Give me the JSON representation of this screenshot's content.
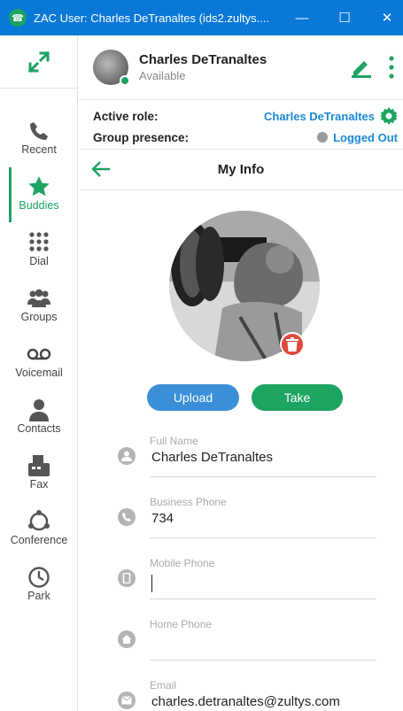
{
  "window": {
    "title": "ZAC User: Charles DeTranaltes (ids2.zultys....",
    "minimize": "—",
    "maximize": "☐",
    "close": "✕"
  },
  "sidebar": {
    "items": [
      {
        "label": "Recent",
        "icon": "phone-icon"
      },
      {
        "label": "Buddies",
        "icon": "star-icon",
        "active": true
      },
      {
        "label": "Dial",
        "icon": "dialpad-icon"
      },
      {
        "label": "Groups",
        "icon": "groups-icon"
      },
      {
        "label": "Voicemail",
        "icon": "voicemail-icon"
      },
      {
        "label": "Contacts",
        "icon": "contacts-icon"
      },
      {
        "label": "Fax",
        "icon": "fax-icon"
      },
      {
        "label": "Conference",
        "icon": "conference-icon"
      },
      {
        "label": "Park",
        "icon": "park-icon"
      }
    ]
  },
  "profile": {
    "name": "Charles DeTranaltes",
    "status": "Available"
  },
  "roles": {
    "active_role_label": "Active role:",
    "active_role_value": "Charles DeTranaltes",
    "group_presence_label": "Group presence:",
    "group_presence_value": "Logged Out"
  },
  "myinfo": {
    "title": "My Info",
    "upload": "Upload",
    "take": "Take"
  },
  "fields": [
    {
      "label": "Full Name",
      "value": "Charles DeTranaltes",
      "icon": "person-icon"
    },
    {
      "label": "Business Phone",
      "value": "734",
      "icon": "phone-icon"
    },
    {
      "label": "Mobile Phone",
      "value": "",
      "icon": "mobile-icon"
    },
    {
      "label": "Home Phone",
      "value": "",
      "icon": "home-icon"
    },
    {
      "label": "Email",
      "value": "charles.detranaltes@zultys.com",
      "icon": "email-icon"
    }
  ],
  "colors": {
    "titlebar": "#0a78d7",
    "accent_green": "#1da362",
    "link_blue": "#1b8ad3",
    "upload_blue": "#3a8fd8",
    "delete_red": "#e04a3f"
  }
}
